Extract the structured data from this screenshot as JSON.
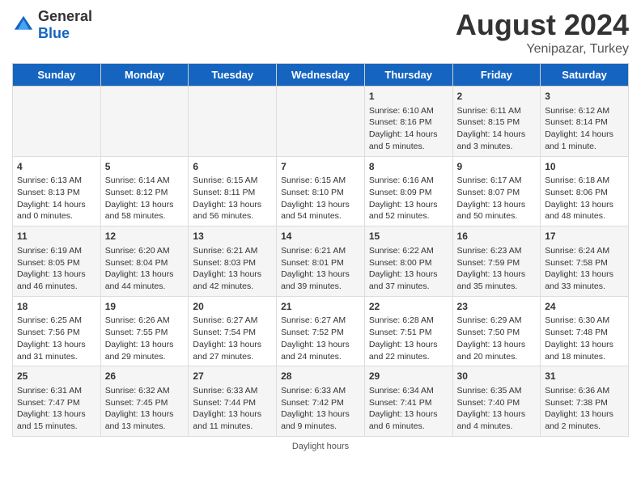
{
  "header": {
    "logo_general": "General",
    "logo_blue": "Blue",
    "main_title": "August 2024",
    "subtitle": "Yenipazar, Turkey"
  },
  "columns": [
    "Sunday",
    "Monday",
    "Tuesday",
    "Wednesday",
    "Thursday",
    "Friday",
    "Saturday"
  ],
  "weeks": [
    {
      "days": [
        {
          "num": "",
          "info": ""
        },
        {
          "num": "",
          "info": ""
        },
        {
          "num": "",
          "info": ""
        },
        {
          "num": "",
          "info": ""
        },
        {
          "num": "1",
          "info": "Sunrise: 6:10 AM\nSunset: 8:16 PM\nDaylight: 14 hours\nand 5 minutes."
        },
        {
          "num": "2",
          "info": "Sunrise: 6:11 AM\nSunset: 8:15 PM\nDaylight: 14 hours\nand 3 minutes."
        },
        {
          "num": "3",
          "info": "Sunrise: 6:12 AM\nSunset: 8:14 PM\nDaylight: 14 hours\nand 1 minute."
        }
      ]
    },
    {
      "days": [
        {
          "num": "4",
          "info": "Sunrise: 6:13 AM\nSunset: 8:13 PM\nDaylight: 14 hours\nand 0 minutes."
        },
        {
          "num": "5",
          "info": "Sunrise: 6:14 AM\nSunset: 8:12 PM\nDaylight: 13 hours\nand 58 minutes."
        },
        {
          "num": "6",
          "info": "Sunrise: 6:15 AM\nSunset: 8:11 PM\nDaylight: 13 hours\nand 56 minutes."
        },
        {
          "num": "7",
          "info": "Sunrise: 6:15 AM\nSunset: 8:10 PM\nDaylight: 13 hours\nand 54 minutes."
        },
        {
          "num": "8",
          "info": "Sunrise: 6:16 AM\nSunset: 8:09 PM\nDaylight: 13 hours\nand 52 minutes."
        },
        {
          "num": "9",
          "info": "Sunrise: 6:17 AM\nSunset: 8:07 PM\nDaylight: 13 hours\nand 50 minutes."
        },
        {
          "num": "10",
          "info": "Sunrise: 6:18 AM\nSunset: 8:06 PM\nDaylight: 13 hours\nand 48 minutes."
        }
      ]
    },
    {
      "days": [
        {
          "num": "11",
          "info": "Sunrise: 6:19 AM\nSunset: 8:05 PM\nDaylight: 13 hours\nand 46 minutes."
        },
        {
          "num": "12",
          "info": "Sunrise: 6:20 AM\nSunset: 8:04 PM\nDaylight: 13 hours\nand 44 minutes."
        },
        {
          "num": "13",
          "info": "Sunrise: 6:21 AM\nSunset: 8:03 PM\nDaylight: 13 hours\nand 42 minutes."
        },
        {
          "num": "14",
          "info": "Sunrise: 6:21 AM\nSunset: 8:01 PM\nDaylight: 13 hours\nand 39 minutes."
        },
        {
          "num": "15",
          "info": "Sunrise: 6:22 AM\nSunset: 8:00 PM\nDaylight: 13 hours\nand 37 minutes."
        },
        {
          "num": "16",
          "info": "Sunrise: 6:23 AM\nSunset: 7:59 PM\nDaylight: 13 hours\nand 35 minutes."
        },
        {
          "num": "17",
          "info": "Sunrise: 6:24 AM\nSunset: 7:58 PM\nDaylight: 13 hours\nand 33 minutes."
        }
      ]
    },
    {
      "days": [
        {
          "num": "18",
          "info": "Sunrise: 6:25 AM\nSunset: 7:56 PM\nDaylight: 13 hours\nand 31 minutes."
        },
        {
          "num": "19",
          "info": "Sunrise: 6:26 AM\nSunset: 7:55 PM\nDaylight: 13 hours\nand 29 minutes."
        },
        {
          "num": "20",
          "info": "Sunrise: 6:27 AM\nSunset: 7:54 PM\nDaylight: 13 hours\nand 27 minutes."
        },
        {
          "num": "21",
          "info": "Sunrise: 6:27 AM\nSunset: 7:52 PM\nDaylight: 13 hours\nand 24 minutes."
        },
        {
          "num": "22",
          "info": "Sunrise: 6:28 AM\nSunset: 7:51 PM\nDaylight: 13 hours\nand 22 minutes."
        },
        {
          "num": "23",
          "info": "Sunrise: 6:29 AM\nSunset: 7:50 PM\nDaylight: 13 hours\nand 20 minutes."
        },
        {
          "num": "24",
          "info": "Sunrise: 6:30 AM\nSunset: 7:48 PM\nDaylight: 13 hours\nand 18 minutes."
        }
      ]
    },
    {
      "days": [
        {
          "num": "25",
          "info": "Sunrise: 6:31 AM\nSunset: 7:47 PM\nDaylight: 13 hours\nand 15 minutes."
        },
        {
          "num": "26",
          "info": "Sunrise: 6:32 AM\nSunset: 7:45 PM\nDaylight: 13 hours\nand 13 minutes."
        },
        {
          "num": "27",
          "info": "Sunrise: 6:33 AM\nSunset: 7:44 PM\nDaylight: 13 hours\nand 11 minutes."
        },
        {
          "num": "28",
          "info": "Sunrise: 6:33 AM\nSunset: 7:42 PM\nDaylight: 13 hours\nand 9 minutes."
        },
        {
          "num": "29",
          "info": "Sunrise: 6:34 AM\nSunset: 7:41 PM\nDaylight: 13 hours\nand 6 minutes."
        },
        {
          "num": "30",
          "info": "Sunrise: 6:35 AM\nSunset: 7:40 PM\nDaylight: 13 hours\nand 4 minutes."
        },
        {
          "num": "31",
          "info": "Sunrise: 6:36 AM\nSunset: 7:38 PM\nDaylight: 13 hours\nand 2 minutes."
        }
      ]
    }
  ],
  "footer": "Daylight hours"
}
